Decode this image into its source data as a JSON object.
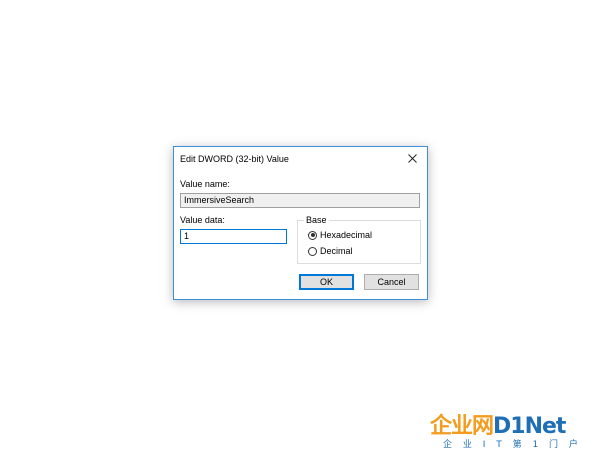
{
  "dialog": {
    "title": "Edit DWORD (32-bit) Value",
    "value_name_label": "Value name:",
    "value_name": "ImmersiveSearch",
    "value_data_label": "Value data:",
    "value_data": "1",
    "base": {
      "label": "Base",
      "options": [
        {
          "label": "Hexadecimal",
          "selected": true
        },
        {
          "label": "Decimal",
          "selected": false
        }
      ]
    },
    "ok_label": "OK",
    "cancel_label": "Cancel"
  },
  "watermark": {
    "brand_prefix": "企业网",
    "brand_suffix": "D1Net",
    "tagline": "企 业 I T 第 1 门 户"
  },
  "colors": {
    "accent": "#0078d7",
    "window_border": "#3c8fd8",
    "watermark_orange": "#f39c1e",
    "watermark_blue": "#1f6fb5"
  }
}
